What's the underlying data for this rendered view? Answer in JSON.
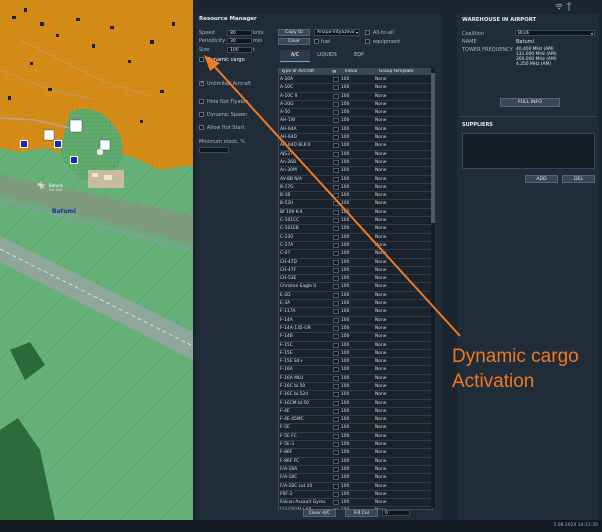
{
  "status_icons": [
    "wifi-icon",
    "antenna-icon"
  ],
  "map": {
    "place_label": "Batumi",
    "airfield_label": "Batumi",
    "airfield_sublabel": "Civ 1A4"
  },
  "resource_manager": {
    "title": "Resource Manager",
    "speed_label": "Speed",
    "speed_value": "80",
    "speed_unit": "knts",
    "periodicity_label": "Periodicity",
    "periodicity_value": "30",
    "periodicity_unit": "min",
    "size_label": "Size",
    "size_value": "100",
    "size_unit": "t",
    "copy_to_label": "Copy to",
    "copy_to_target": "Anapa-Vityazevo",
    "clear_label": "Clear",
    "fuel_label": "fuel",
    "all_to_all_label": "All-to-all",
    "equipment_label": "equipment",
    "options": [
      {
        "label": "Dynamic cargo",
        "checked": false
      },
      {
        "label": "Unlimited Aircraft",
        "checked": true
      },
      {
        "label": "Hide Not Flyable",
        "checked": false
      },
      {
        "label": "Dynamic Spawn",
        "checked": false
      },
      {
        "label": "Allow Hot Start",
        "checked": false
      }
    ],
    "minimum_stock_label": "Minimum stock, %",
    "tabs": [
      "A/C",
      "LIQUIDS",
      "EQP"
    ],
    "table": {
      "headers": [
        "Type of Aircraft",
        "∞",
        "Initial",
        "Group template"
      ],
      "rows": [
        [
          "A-10A",
          "100",
          "None"
        ],
        [
          "A-10C",
          "100",
          "None"
        ],
        [
          "A-10C II",
          "100",
          "None"
        ],
        [
          "A-20G",
          "100",
          "None"
        ],
        [
          "A-50",
          "100",
          "None"
        ],
        [
          "AH-1W",
          "100",
          "None"
        ],
        [
          "AH-64A",
          "100",
          "None"
        ],
        [
          "AH-64D",
          "100",
          "None"
        ],
        [
          "AH-64D BLK.II",
          "100",
          "None"
        ],
        [
          "AJS37",
          "100",
          "None"
        ],
        [
          "An-26B",
          "100",
          "None"
        ],
        [
          "An-30M",
          "100",
          "None"
        ],
        [
          "AV-8B N/A",
          "100",
          "None"
        ],
        [
          "B-17G",
          "100",
          "None"
        ],
        [
          "B-1B",
          "100",
          "None"
        ],
        [
          "B-52H",
          "100",
          "None"
        ],
        [
          "Bf 109 K-4",
          "100",
          "None"
        ],
        [
          "C-101CC",
          "100",
          "None"
        ],
        [
          "C-101EB",
          "100",
          "None"
        ],
        [
          "C-130",
          "100",
          "None"
        ],
        [
          "C-17A",
          "100",
          "None"
        ],
        [
          "C-47",
          "100",
          "None"
        ],
        [
          "CH-47D",
          "100",
          "None"
        ],
        [
          "CH-47F",
          "100",
          "None"
        ],
        [
          "CH-53E",
          "100",
          "None"
        ],
        [
          "Christen Eagle II",
          "100",
          "None"
        ],
        [
          "E-2D",
          "100",
          "None"
        ],
        [
          "E-3A",
          "100",
          "None"
        ],
        [
          "F-117A",
          "100",
          "None"
        ],
        [
          "F-14A",
          "100",
          "None"
        ],
        [
          "F-14A-135-GR",
          "100",
          "None"
        ],
        [
          "F-14B",
          "100",
          "None"
        ],
        [
          "F-15C",
          "100",
          "None"
        ],
        [
          "F-15E",
          "100",
          "None"
        ],
        [
          "F-15E S4+",
          "100",
          "None"
        ],
        [
          "F-16A",
          "100",
          "None"
        ],
        [
          "F-16A MLU",
          "100",
          "None"
        ],
        [
          "F-16C bl.50",
          "100",
          "None"
        ],
        [
          "F-16C bl.52d",
          "100",
          "None"
        ],
        [
          "F-16CM bl.50",
          "100",
          "None"
        ],
        [
          "F-4E",
          "100",
          "None"
        ],
        [
          "F-4E-45MC",
          "100",
          "None"
        ],
        [
          "F-5E",
          "100",
          "None"
        ],
        [
          "F-5E FC",
          "100",
          "None"
        ],
        [
          "F-5E-3",
          "100",
          "None"
        ],
        [
          "F-86F",
          "100",
          "None"
        ],
        [
          "F-86F FC",
          "100",
          "None"
        ],
        [
          "F/A-18A",
          "100",
          "None"
        ],
        [
          "F/A-18C",
          "100",
          "None"
        ],
        [
          "F/A-18C Lot 20",
          "100",
          "None"
        ],
        [
          "F6F-3",
          "100",
          "None"
        ],
        [
          "Falcon Assault Gyros",
          "100",
          "None"
        ],
        [
          "FULCRUM-LAB",
          "100",
          "None"
        ],
        [
          "Fw 190 A-8",
          "100",
          "None"
        ],
        [
          "Fw 190 D-9",
          "100",
          "None"
        ]
      ]
    },
    "clear_ac_label": "Clear A/C",
    "fill_col_label": "Fill Col",
    "fill_col_value": "0"
  },
  "warehouse": {
    "title": "WAREHOUSE IN AIRPORT",
    "coalition_label": "Coalition",
    "coalition_value": "BLUE",
    "name_label": "NAME",
    "name_value": "Batumi",
    "tower_label": "TOWER FREQUENCY",
    "frequencies": [
      "40.400  MHz  (AM)",
      "131.000  MHz  (AM)",
      "260.000  MHz  (AM)",
      "4.250  MHz  (AM)"
    ],
    "full_info_label": "FULL INFO",
    "suppliers_label": "SUPPLIERS",
    "add_label": "ADD",
    "del_label": "DEL"
  },
  "status_bar": {
    "datetime": "5.08.2024 14:21:30"
  },
  "annotation": {
    "line1": "Dynamic cargo",
    "line2": "Activation",
    "color": "#ee7a22"
  }
}
